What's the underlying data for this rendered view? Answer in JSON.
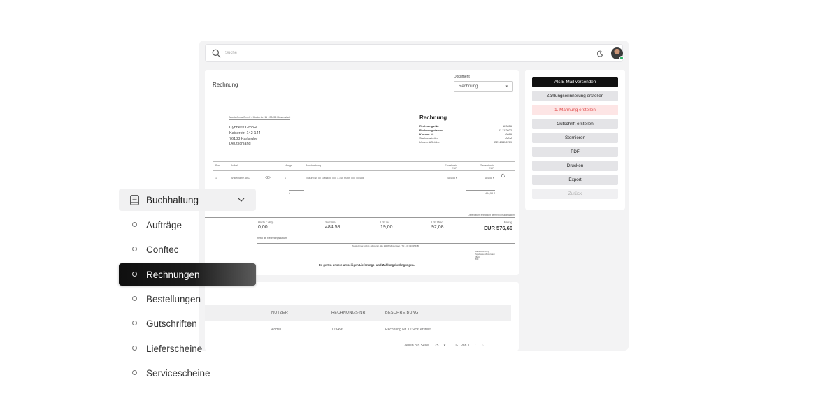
{
  "search": {
    "placeholder": "Suche"
  },
  "invoice": {
    "card_title": "Rechnung",
    "document_label": "Dokument",
    "document_select": "Rechnung",
    "sender_line": "Musterfirma GmbH • Musterstr. 11 • 23456 Musterstadt",
    "recipient": [
      "Cybnetix GmbH",
      "Kaiserstr. 142-144",
      "76133 Karlsruhe",
      "Deutschland"
    ],
    "heading": "Rechnung",
    "meta": [
      {
        "label": "Rechnungs-Nr.",
        "value": "123456"
      },
      {
        "label": "Rechnungsdatum",
        "value": "11.11.2022"
      },
      {
        "label": "Kunden-Nr.",
        "value": "6669"
      },
      {
        "label": "Sachbearbeiter",
        "value": "ADM"
      },
      {
        "label": "Unsere USt-Idnr.",
        "value": "DE123456789"
      }
    ],
    "columns": {
      "pos": "Pos",
      "artikel": "Artikel",
      "menge": "Menge",
      "beschreibung": "Beschreibung",
      "einzelpreis": "Einzelpreis",
      "einzelpreis_unit": "EUR",
      "gesamtpreis": "Gesamtpreis",
      "gesamtpreis_unit": "EUR"
    },
    "row": {
      "pos": "1",
      "artikel": "Artikelname ABC",
      "menge": "1",
      "beschreibung": "Tissung W 50 Glasgold 000 1,14g Platin 000 / 0,43g",
      "einzelpreis": "484,58 €",
      "gesamtpreis": "484,58 €"
    },
    "qty_total": "1",
    "sum_total": "484,58 €",
    "liefer_note": "Lieferdatum entspricht dem Rechnungsdatum",
    "totals": [
      {
        "label": "Porto / Verp.",
        "value": "0,00"
      },
      {
        "label": "Summe",
        "value": "484,58"
      },
      {
        "label": "USt %",
        "value": "19,00"
      },
      {
        "label": "USt Wert",
        "value": "92,08"
      },
      {
        "label": "Betrag",
        "value": "EUR 576,66"
      }
    ],
    "zahlbar": "netto ab Rechnungsdatum",
    "footer": "Musterfirma GmbH • Musterstr. 11 • 23456 Musterstadt • Tel: +49 123 456789",
    "bank": [
      "Bankverbindung",
      "Sparkasse Musterstadt",
      "IBAN",
      "BIC"
    ],
    "agb": "Es gelten unsere umseitigen Lieferungs- und Zahlungsbedingungen."
  },
  "actions": [
    {
      "label": "Als E-Mail versenden",
      "style": "primary",
      "name": "email-send-button"
    },
    {
      "label": "Zahlungserinnerung erstellen",
      "style": "default",
      "name": "payment-reminder-button"
    },
    {
      "label": "1. Mahnung erstellen",
      "style": "danger",
      "name": "dunning-button"
    },
    {
      "label": "Gutschrift erstellen",
      "style": "default",
      "name": "credit-note-button"
    },
    {
      "label": "Stornieren",
      "style": "default",
      "name": "cancel-invoice-button"
    },
    {
      "label": "PDF",
      "style": "default",
      "name": "pdf-button"
    },
    {
      "label": "Drucken",
      "style": "default",
      "name": "print-button"
    },
    {
      "label": "Export",
      "style": "default",
      "name": "export-button"
    },
    {
      "label": "Zurück",
      "style": "disabled",
      "name": "back-button"
    }
  ],
  "history": {
    "columns": {
      "nutzer": "NUTZER",
      "nr": "RECHNUNGS-NR.",
      "beschreibung": "BESCHREIBUNG"
    },
    "rows": [
      {
        "nutzer": "Admin",
        "nr": "123456",
        "beschreibung": "Rechnung Nr. 123456 erstellt"
      }
    ],
    "pager": {
      "rows_label": "Zeilen pro Seite:",
      "rows_value": "25",
      "range": "1-1 von 1"
    }
  },
  "sidebar": {
    "group_label": "Buchhaltung",
    "items": [
      {
        "label": "Aufträge",
        "active": false
      },
      {
        "label": "Conftec",
        "active": false
      },
      {
        "label": "Rechnungen",
        "active": true
      },
      {
        "label": "Bestellungen",
        "active": false
      },
      {
        "label": "Gutschriften",
        "active": false
      },
      {
        "label": "Lieferscheine",
        "active": false
      },
      {
        "label": "Servicescheine",
        "active": false
      }
    ]
  }
}
